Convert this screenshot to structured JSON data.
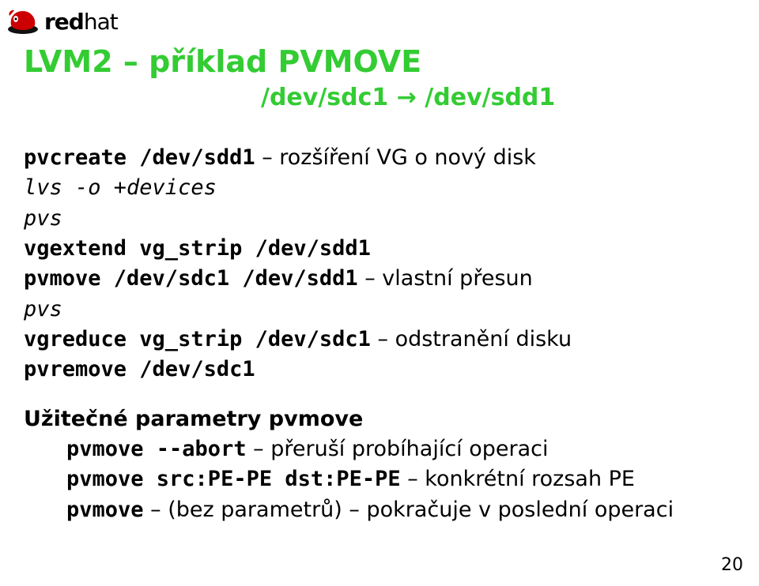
{
  "logo": {
    "part1": "red",
    "part2": "hat"
  },
  "title": "LVM2 – příklad PVMOVE",
  "subtitle": "/dev/sdc1 → /dev/sdd1",
  "lines": {
    "l1_cmd": "pvcreate /dev/sdd1",
    "l1_desc": " – rozšíření VG o nový disk",
    "l2": "lvs -o +devices",
    "l3": "pvs",
    "l4_cmd": "vgextend vg_strip /dev/sdd1",
    "l5_cmd": "pvmove /dev/sdc1 /dev/sdd1",
    "l5_desc": " – vlastní přesun",
    "l6": "pvs",
    "l7_cmd": "vgreduce vg_strip /dev/sdc1",
    "l7_desc": " – odstranění disku",
    "l8_cmd": "pvremove /dev/sdc1"
  },
  "para2": {
    "heading": "Užitečné parametry pvmove",
    "p1_cmd": "pvmove --abort",
    "p1_desc": " – přeruší probíhající operaci",
    "p2_cmd": "pvmove src:PE-PE dst:PE-PE",
    "p2_desc": " – konkrétní rozsah PE",
    "p3_cmd": "pvmove",
    "p3_desc": " – (bez parametrů) – pokračuje v poslední operaci"
  },
  "pagenum": "20"
}
